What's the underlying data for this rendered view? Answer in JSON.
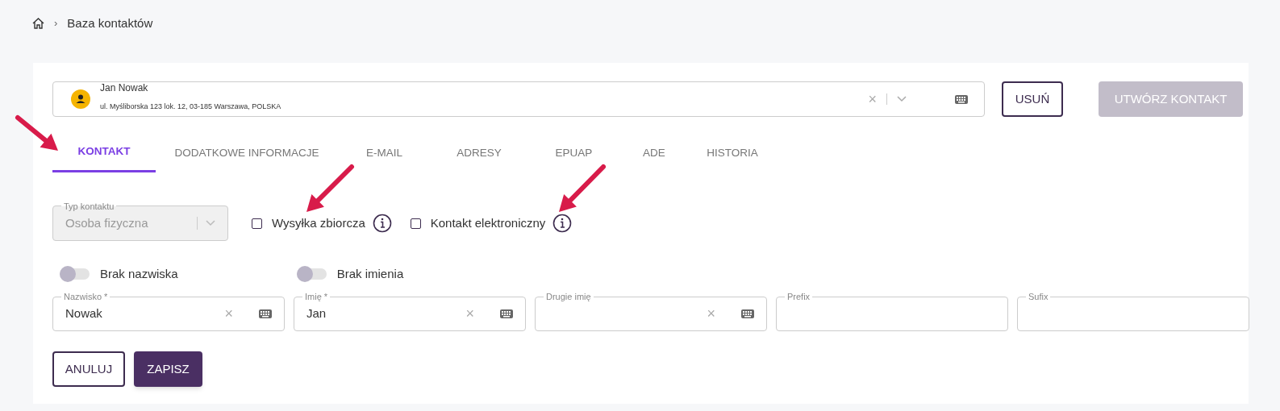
{
  "breadcrumb": {
    "separator": "›",
    "current": "Baza kontaktów"
  },
  "contact_picker": {
    "name": "Jan Nowak",
    "address": "ul. Myśliborska 123 lok. 12, 03-185 Warszawa, POLSKA",
    "clear": "×"
  },
  "header_buttons": [
    {
      "label": "USUŃ",
      "disabled": false,
      "kind": "outline"
    },
    {
      "label": "UTWÓRZ KONTAKT",
      "disabled": true,
      "kind": "filled"
    }
  ],
  "tabs": [
    {
      "label": "KONTAKT",
      "selected": true
    },
    {
      "label": "DODATKOWE INFORMACJE",
      "selected": false
    },
    {
      "label": "E-MAIL",
      "selected": false
    },
    {
      "label": "ADRESY",
      "selected": false
    },
    {
      "label": "EPUAP",
      "selected": false
    },
    {
      "label": "ADE",
      "selected": false
    },
    {
      "label": "HISTORIA",
      "selected": false
    }
  ],
  "contact_type": {
    "label": "Typ kontaktu",
    "value": "Osoba fizyczna",
    "disabled": true
  },
  "checkboxes": [
    {
      "label": "Wysyłka zbiorcza",
      "checked": false
    },
    {
      "label": "Kontakt elektroniczny",
      "checked": false
    }
  ],
  "toggles": [
    {
      "label": "Brak nazwiska",
      "on": false
    },
    {
      "label": "Brak imienia",
      "on": false
    }
  ],
  "fields": [
    {
      "label": "Nazwisko *",
      "value": "Nowak",
      "kind": "keyboard"
    },
    {
      "label": "Imię *",
      "value": "Jan",
      "kind": "keyboard"
    },
    {
      "label": "Drugie imię",
      "kind": "keyboard"
    },
    {
      "label": "Prefix",
      "kind": "plain"
    },
    {
      "label": "Sufix",
      "kind": "plain"
    }
  ],
  "clear_mark": "×",
  "form_buttons": [
    {
      "label": "ANULUJ",
      "kind": "outline"
    },
    {
      "label": "ZAPISZ",
      "kind": "filled"
    }
  ]
}
